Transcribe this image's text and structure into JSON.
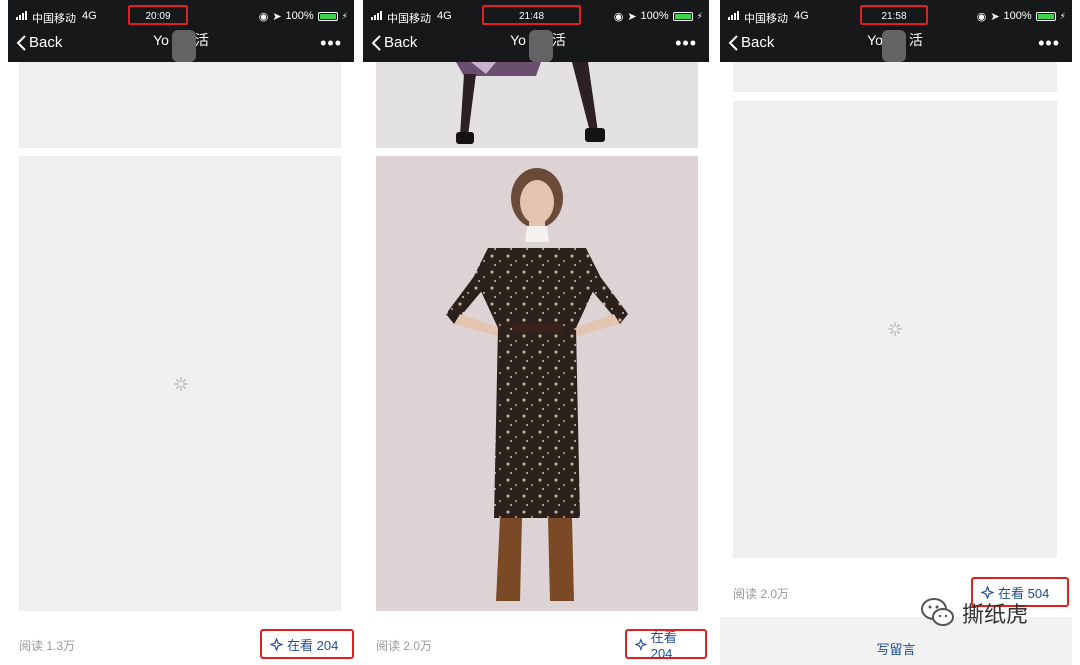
{
  "panels": [
    {
      "carrier": "中国移动",
      "network": "4G",
      "time": "20:09",
      "battery": "100%",
      "back": "Back",
      "title_start": "Yo",
      "title_end": "活",
      "read_label": "阅读 1.3万",
      "looking_label": "在看 204",
      "content": "loading"
    },
    {
      "carrier": "中国移动",
      "network": "4G",
      "time": "21:48",
      "battery": "100%",
      "back": "Back",
      "title_start": "Yo",
      "title_end": "活",
      "read_label": "阅读 2.0万",
      "looking_label": "在看 204",
      "content": "photo"
    },
    {
      "carrier": "中国移动",
      "network": "4G",
      "time": "21:58",
      "battery": "100%",
      "back": "Back",
      "title_start": "Yo",
      "title_end": "活",
      "read_label": "阅读 2.0万",
      "looking_label": "在看 504",
      "write_comment": "写留言",
      "content": "loading"
    }
  ],
  "more_label": "•••",
  "watermark": "撕纸虎",
  "colors": {
    "highlight": "#e02020",
    "link": "#1e4e94",
    "nav_bg": "#16181a",
    "battery": "#3ed14b",
    "placeholder": "#efefef"
  },
  "icons": [
    "back-chevron-icon",
    "location-arrow-icon",
    "lock-rotation-icon",
    "battery-icon",
    "spinner-icon",
    "looking-sparkle-icon",
    "wechat-logo-icon"
  ]
}
